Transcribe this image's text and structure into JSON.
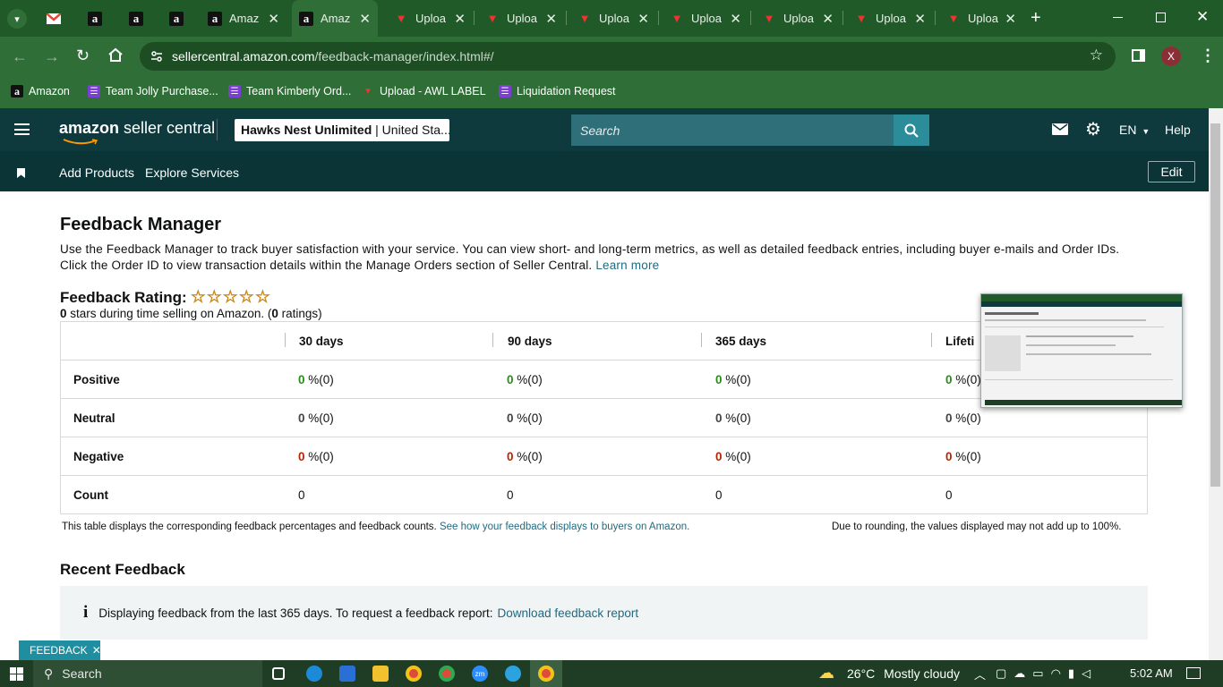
{
  "browser": {
    "tabs": [
      {
        "icon": "gmail-icon",
        "title": ""
      },
      {
        "icon": "amazon-icon",
        "title": ""
      },
      {
        "icon": "amazon-icon",
        "title": ""
      },
      {
        "icon": "amazon-icon",
        "title": ""
      },
      {
        "icon": "amazon-icon",
        "title": "Amaz"
      },
      {
        "icon": "amazon-icon",
        "title": "Amaz"
      },
      {
        "icon": "upload-icon",
        "title": "Uploa"
      },
      {
        "icon": "upload-icon",
        "title": "Uploa"
      },
      {
        "icon": "upload-icon",
        "title": "Uploa"
      },
      {
        "icon": "upload-icon",
        "title": "Uploa"
      },
      {
        "icon": "upload-icon",
        "title": "Uploa"
      },
      {
        "icon": "upload-icon",
        "title": "Uploa"
      },
      {
        "icon": "upload-icon",
        "title": "Uploa"
      }
    ],
    "url_host": "sellercentral.amazon.com",
    "url_path": "/feedback-manager/index.html#/",
    "profile_initial": "X",
    "bookmarks": [
      "Amazon",
      "Team Jolly Purchase...",
      "Team Kimberly Ord...",
      "Upload - AWL LABEL",
      "Liquidation Request"
    ]
  },
  "header": {
    "logo_amazon": "amazon",
    "logo_rest": " seller central",
    "store_name": "Hawks Nest Unlimited",
    "store_region": " | United Sta...",
    "search_placeholder": "Search",
    "language": "EN",
    "help": "Help"
  },
  "nav": {
    "items": [
      "Add Products",
      "Explore Services"
    ],
    "edit": "Edit"
  },
  "page": {
    "title": "Feedback Manager",
    "description": "Use the Feedback Manager to track buyer satisfaction with your service. You can view short- and long-term metrics, as well as detailed feedback entries, including buyer e-mails and Order IDs. Click the Order ID to view transaction details within the Manage Orders section of Seller Central.",
    "learn_more": "Learn more",
    "rating_label": "Feedback Rating:",
    "stars": "☆☆☆☆☆",
    "rating_stars_value": "0",
    "rating_mid": " stars during time selling on Amazon. (",
    "rating_count": "0",
    "rating_end": " ratings)"
  },
  "table": {
    "columns": [
      "30 days",
      "90 days",
      "365 days",
      "Lifeti"
    ],
    "rows": [
      {
        "label": "Positive",
        "values": [
          "0",
          "0",
          "0",
          "0"
        ],
        "suffix": [
          " %(0)",
          " %(0)",
          " %(0)",
          " %(0)"
        ]
      },
      {
        "label": "Neutral",
        "values": [
          "0",
          "0",
          "0",
          "0"
        ],
        "suffix": [
          " %(0)",
          " %(0)",
          " %(0)",
          " %(0)"
        ]
      },
      {
        "label": "Negative",
        "values": [
          "0",
          "0",
          "0",
          "0"
        ],
        "suffix": [
          " %(0)",
          " %(0)",
          " %(0)",
          " %(0)"
        ]
      },
      {
        "label": "Count",
        "values": [
          "0",
          "0",
          "0",
          "0"
        ]
      }
    ],
    "note_left": "This table displays the corresponding feedback percentages and feedback counts.",
    "note_link": "See how your feedback displays to buyers on Amazon.",
    "note_right": "Due to rounding, the values displayed may not add up to 100%."
  },
  "recent": {
    "title": "Recent Feedback",
    "info": "Displaying feedback from the last 365 days. To request a feedback report:",
    "info_link": "Download feedback report",
    "feedback_tab": "FEEDBACK"
  },
  "taskbar": {
    "search": "Search",
    "temperature": "26°C",
    "weather": "Mostly cloudy",
    "time": "5:02 AM"
  },
  "colors": {
    "browser_frame": "#2f6f37",
    "sc_header": "#0f3a3d",
    "positive": "#2a8a1b",
    "negative": "#b12704",
    "link": "#1e6a82"
  }
}
